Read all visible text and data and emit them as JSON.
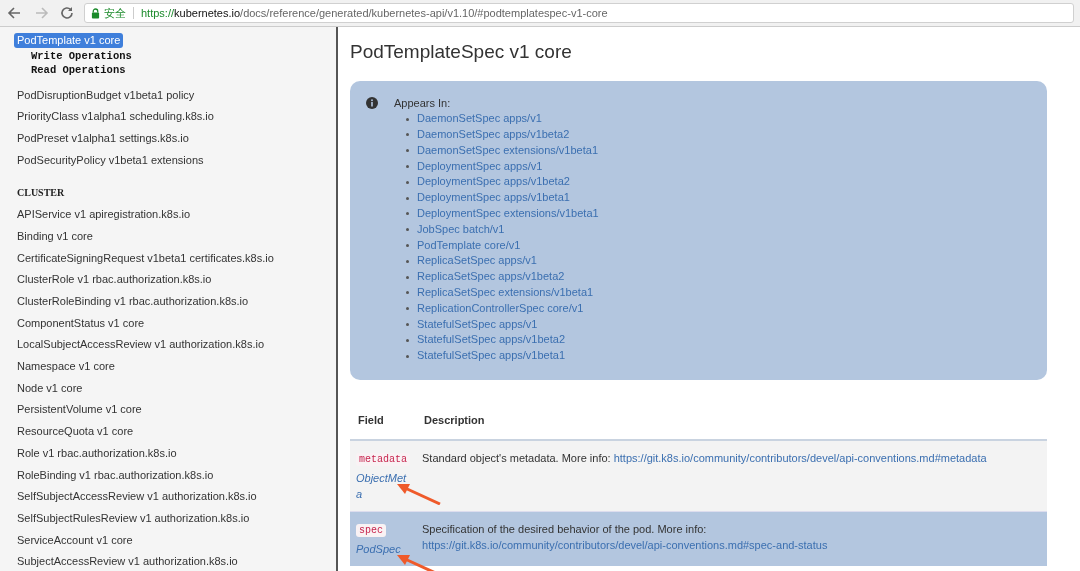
{
  "browser": {
    "security_label": "安全",
    "address": {
      "scheme": "https://",
      "host": "kubernetes.io",
      "path": "/docs/reference/generated/kubernetes-api/v1.10/#podtemplatespec-v1-core"
    }
  },
  "sidebar": {
    "items": [
      {
        "kind": "link",
        "label": "PodTemplate v1 core",
        "selected": true
      },
      {
        "kind": "operation",
        "label": "Write Operations"
      },
      {
        "kind": "operation",
        "label": "Read Operations"
      },
      {
        "kind": "link",
        "label": "PodDisruptionBudget v1beta1 policy",
        "selected": false
      },
      {
        "kind": "link",
        "label": "PriorityClass v1alpha1 scheduling.k8s.io",
        "selected": false
      },
      {
        "kind": "link",
        "label": "PodPreset v1alpha1 settings.k8s.io",
        "selected": false
      },
      {
        "kind": "link",
        "label": "PodSecurityPolicy v1beta1 extensions",
        "selected": false
      },
      {
        "kind": "heading",
        "label": "CLUSTER"
      },
      {
        "kind": "link",
        "label": "APIService v1 apiregistration.k8s.io",
        "selected": false
      },
      {
        "kind": "link",
        "label": "Binding v1 core",
        "selected": false
      },
      {
        "kind": "link",
        "label": "CertificateSigningRequest v1beta1 certificates.k8s.io",
        "selected": false
      },
      {
        "kind": "link",
        "label": "ClusterRole v1 rbac.authorization.k8s.io",
        "selected": false
      },
      {
        "kind": "link",
        "label": "ClusterRoleBinding v1 rbac.authorization.k8s.io",
        "selected": false
      },
      {
        "kind": "link",
        "label": "ComponentStatus v1 core",
        "selected": false
      },
      {
        "kind": "link",
        "label": "LocalSubjectAccessReview v1 authorization.k8s.io",
        "selected": false
      },
      {
        "kind": "link",
        "label": "Namespace v1 core",
        "selected": false
      },
      {
        "kind": "link",
        "label": "Node v1 core",
        "selected": false
      },
      {
        "kind": "link",
        "label": "PersistentVolume v1 core",
        "selected": false
      },
      {
        "kind": "link",
        "label": "ResourceQuota v1 core",
        "selected": false
      },
      {
        "kind": "link",
        "label": "Role v1 rbac.authorization.k8s.io",
        "selected": false
      },
      {
        "kind": "link",
        "label": "RoleBinding v1 rbac.authorization.k8s.io",
        "selected": false
      },
      {
        "kind": "link",
        "label": "SelfSubjectAccessReview v1 authorization.k8s.io",
        "selected": false
      },
      {
        "kind": "link",
        "label": "SelfSubjectRulesReview v1 authorization.k8s.io",
        "selected": false
      },
      {
        "kind": "link",
        "label": "ServiceAccount v1 core",
        "selected": false
      },
      {
        "kind": "link",
        "label": "SubjectAccessReview v1 authorization.k8s.io",
        "selected": false
      }
    ]
  },
  "main": {
    "title": "PodTemplateSpec v1 core",
    "appears_in": {
      "label": "Appears In:",
      "links": [
        "DaemonSetSpec apps/v1",
        "DaemonSetSpec apps/v1beta2",
        "DaemonSetSpec extensions/v1beta1",
        "DeploymentSpec apps/v1",
        "DeploymentSpec apps/v1beta2",
        "DeploymentSpec apps/v1beta1",
        "DeploymentSpec extensions/v1beta1",
        "JobSpec batch/v1",
        "PodTemplate core/v1",
        "ReplicaSetSpec apps/v1",
        "ReplicaSetSpec apps/v1beta2",
        "ReplicaSetSpec extensions/v1beta1",
        "ReplicationControllerSpec core/v1",
        "StatefulSetSpec apps/v1",
        "StatefulSetSpec apps/v1beta2",
        "StatefulSetSpec apps/v1beta1"
      ]
    },
    "table": {
      "columns": [
        "Field",
        "Description"
      ],
      "rows": [
        {
          "field": "metadata",
          "type": "ObjectMeta",
          "description": "Standard object's metadata. More info:",
          "link": "https://git.k8s.io/community/contributors/devel/api-conventions.md#metadata",
          "selected": false
        },
        {
          "field": "spec",
          "type": "PodSpec",
          "description": "Specification of the desired behavior of the pod. More info:",
          "link": "https://git.k8s.io/community/contributors/devel/api-conventions.md#spec-and-status",
          "selected": true
        }
      ]
    }
  }
}
